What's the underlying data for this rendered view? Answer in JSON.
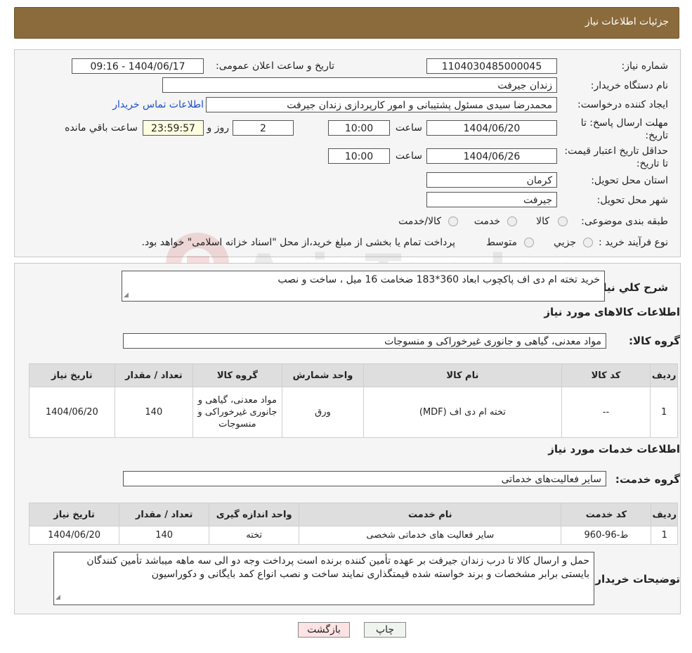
{
  "title": "جزئیات اطلاعات نیاز",
  "fields": {
    "need_number_label": "شماره نیاز:",
    "need_number": "1104030485000045",
    "announce_label": "تاریخ و ساعت اعلان عمومی:",
    "announce_value": "1404/06/17 - 09:16",
    "buyer_org_label": "نام دستگاه خریدار:",
    "buyer_org": "زندان جیرفت",
    "requester_label": "ایجاد کننده درخواست:",
    "requester": "محمدرضا سیدی مسئول پشتیبانی و امور کارپردازی زندان جیرفت",
    "contact_link": "اطلاعات تماس خریدار",
    "deadline_label": "مهلت ارسال پاسخ: تا تاریخ:",
    "deadline_date": "1404/06/20",
    "time_label": "ساعت",
    "deadline_time": "10:00",
    "days_value": "2",
    "days_label": "روز و",
    "remaining_time": "23:59:57",
    "remaining_label": "ساعت باقي مانده",
    "validity_label": "حداقل تاریخ اعتبار قیمت: تا تاریخ:",
    "validity_date": "1404/06/26",
    "validity_time": "10:00",
    "province_label": "استان محل تحویل:",
    "province": "کرمان",
    "city_label": "شهر محل تحویل:",
    "city": "جیرفت",
    "category_label": "طبقه بندی موضوعی:",
    "category_options": [
      "کالا",
      "خدمت",
      "کالا/خدمت"
    ],
    "process_label": "نوع فرآیند خرید :",
    "process_options": [
      "جزیي",
      "متوسط"
    ],
    "process_note": "پرداخت تمام یا بخشی از مبلغ خرید،از محل \"اسناد خزانه اسلامی\" خواهد بود."
  },
  "watermark": "AriaTender.neT",
  "summary": {
    "label": "شرح کلي نیاز:",
    "text": "خرید تخته ام دی اف پاکچوب ابعاد 360*183 ضخامت 16 میل ، ساخت و نصب"
  },
  "goods": {
    "heading": "اطلاعات کالاهای مورد نیاز",
    "group_label": "گروه کالا:",
    "group_value": "مواد معدنی، گیاهی و جانوری غیرخوراکی و منسوجات",
    "columns": [
      "ردیف",
      "کد کالا",
      "نام کالا",
      "واحد شمارش",
      "گروه کالا",
      "تعداد / مقدار",
      "تاریخ نیاز"
    ],
    "rows": [
      [
        "1",
        "--",
        "تخته ام دی اف (MDF)",
        "ورق",
        "مواد معدنی، گیاهی و جانوری غیرخوراکی و منسوجات",
        "140",
        "1404/06/20"
      ]
    ]
  },
  "services": {
    "heading": "اطلاعات خدمات مورد نیاز",
    "group_label": "گروه خدمت:",
    "group_value": "سایر فعالیت‌های خدماتی",
    "columns": [
      "ردیف",
      "کد خدمت",
      "نام خدمت",
      "واحد اندازه گیری",
      "تعداد / مقدار",
      "تاریخ نیاز"
    ],
    "rows": [
      [
        "1",
        "ط-96-960",
        "سایر فعالیت های خدماتی شخصی",
        "تخته",
        "140",
        "1404/06/20"
      ]
    ]
  },
  "buyer_notes": {
    "label": "توضیحات خریدار:",
    "text": "حمل و ارسال کالا تا درب زندان جیرفت بر عهده تأمین کننده برنده است پرداخت وجه دو الی سه ماهه میباشد تأمین کنندگان بایستی برابر مشخصات و برند خواسته شده قیمتگذاری نمایند ساخت و نصب انواع کمد بایگانی و دکوراسیون"
  },
  "buttons": {
    "print": "چاپ",
    "back": "بازگشت"
  },
  "colors": {
    "header_bg": "#8b6b3c",
    "link": "#1a4fcf",
    "back_button_bg": "#fde3e3"
  }
}
